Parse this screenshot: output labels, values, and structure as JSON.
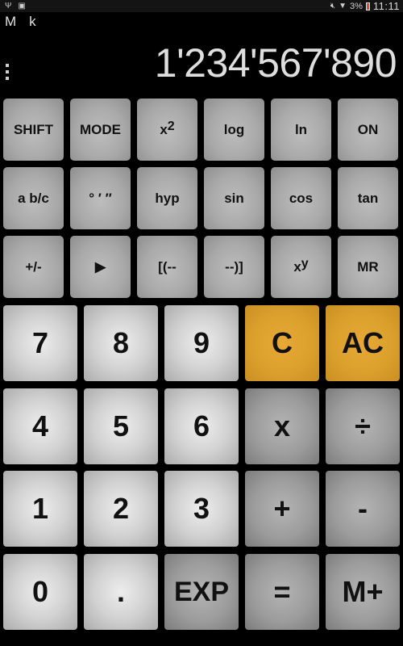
{
  "status_bar": {
    "left_icons": [
      "usb-icon",
      "image-icon"
    ],
    "right_icons": [
      "mute-icon",
      "wifi-icon"
    ],
    "battery_percent": "3%",
    "time": "11:11"
  },
  "indicators": {
    "memory": "M",
    "kilo": "k"
  },
  "display": {
    "value": "1'234'567'890"
  },
  "function_keys": [
    {
      "id": "shift",
      "label": "SHIFT"
    },
    {
      "id": "mode",
      "label": "MODE"
    },
    {
      "id": "square",
      "label": "x",
      "sup": "2"
    },
    {
      "id": "log",
      "label": "log"
    },
    {
      "id": "ln",
      "label": "ln"
    },
    {
      "id": "on",
      "label": "ON"
    },
    {
      "id": "fraction",
      "label": "a b/c"
    },
    {
      "id": "degrees",
      "label": "° ′ ″"
    },
    {
      "id": "hyp",
      "label": "hyp"
    },
    {
      "id": "sin",
      "label": "sin"
    },
    {
      "id": "cos",
      "label": "cos"
    },
    {
      "id": "tan",
      "label": "tan"
    },
    {
      "id": "sign",
      "label": "+/-"
    },
    {
      "id": "play",
      "label": "▶"
    },
    {
      "id": "open-paren",
      "label": "[(--"
    },
    {
      "id": "close-paren",
      "label": "--)]"
    },
    {
      "id": "power",
      "label": "x",
      "sup": "y"
    },
    {
      "id": "mr",
      "label": "MR"
    }
  ],
  "main_keys": [
    {
      "id": "7",
      "label": "7",
      "style": "digit"
    },
    {
      "id": "8",
      "label": "8",
      "style": "digit"
    },
    {
      "id": "9",
      "label": "9",
      "style": "digit"
    },
    {
      "id": "c",
      "label": "C",
      "style": "orange"
    },
    {
      "id": "ac",
      "label": "AC",
      "style": "orange"
    },
    {
      "id": "4",
      "label": "4",
      "style": "digit"
    },
    {
      "id": "5",
      "label": "5",
      "style": "digit"
    },
    {
      "id": "6",
      "label": "6",
      "style": "digit"
    },
    {
      "id": "multiply",
      "label": "x",
      "style": "op"
    },
    {
      "id": "divide",
      "label": "÷",
      "style": "op"
    },
    {
      "id": "1",
      "label": "1",
      "style": "digit"
    },
    {
      "id": "2",
      "label": "2",
      "style": "digit"
    },
    {
      "id": "3",
      "label": "3",
      "style": "digit"
    },
    {
      "id": "plus",
      "label": "+",
      "style": "op"
    },
    {
      "id": "minus",
      "label": "-",
      "style": "op"
    },
    {
      "id": "0",
      "label": "0",
      "style": "digit"
    },
    {
      "id": "decimal",
      "label": ".",
      "style": "digit"
    },
    {
      "id": "exp",
      "label": "EXP",
      "style": "op"
    },
    {
      "id": "equals",
      "label": "=",
      "style": "op"
    },
    {
      "id": "m-plus",
      "label": "M+",
      "style": "op"
    }
  ],
  "colors": {
    "accent_orange": "#dba02c",
    "digit_key": "#d2d2d2",
    "op_key": "#9c9c9c",
    "function_key": "#a9a9a9"
  }
}
